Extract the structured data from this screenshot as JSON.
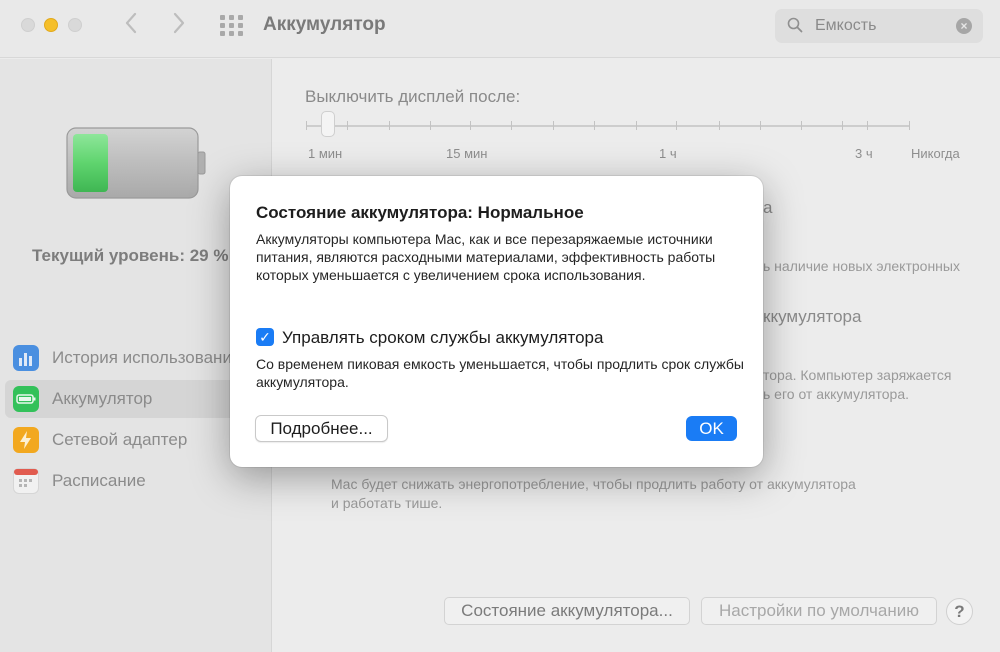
{
  "window": {
    "title": "Аккумулятор"
  },
  "search": {
    "value": "Емкость"
  },
  "sidebar": {
    "current_level": "Текущий уровень: 29 %",
    "items": [
      {
        "label": "История использования",
        "icon": "chart-icon",
        "color": "#4a8fe0"
      },
      {
        "label": "Аккумулятор",
        "icon": "battery-icon",
        "color": "#33c15a"
      },
      {
        "label": "Сетевой адаптер",
        "icon": "bolt-icon",
        "color": "#f2a81f"
      },
      {
        "label": "Расписание",
        "icon": "calendar-icon",
        "color": "#e15b4f"
      }
    ],
    "battery_level": 0.29
  },
  "main": {
    "display_off_label": "Выключить дисплей после:",
    "slider_labels": [
      "1 мин",
      "15 мин",
      "1 ч",
      "3 ч",
      "Никогда"
    ],
    "partial_1": "а",
    "partial_2": "ь наличие новых электронных",
    "partial_3": "ккумулятора",
    "partial_4": "тора. Компьютер заряжается",
    "partial_5": "ь его от аккумулятора.",
    "low_power_desc_1": "Mac будет снижать энергопотребление, чтобы продлить работу от аккумулятора",
    "low_power_desc_2": "и работать тише.",
    "battery_health_button": "Состояние аккумулятора...",
    "restore_defaults_button": "Настройки по умолчанию",
    "help_button": "?"
  },
  "dialog": {
    "title": "Состояние аккумулятора: Нормальное",
    "body": "Аккумуляторы компьютера Mac, как и все перезаряжаемые источники питания, являются расходными материалами, эффективность работы которых уменьшается с увеличением срока использования.",
    "checkbox_label": "Управлять сроком службы аккумулятора",
    "checkbox_checked": true,
    "checkbox_desc": "Со временем пиковая емкость уменьшается, чтобы продлить срок службы аккумулятора.",
    "more_button": "Подробнее...",
    "ok_button": "OK"
  },
  "colors": {
    "accent": "#1a7cf5",
    "battery_green": "#4cd964"
  }
}
